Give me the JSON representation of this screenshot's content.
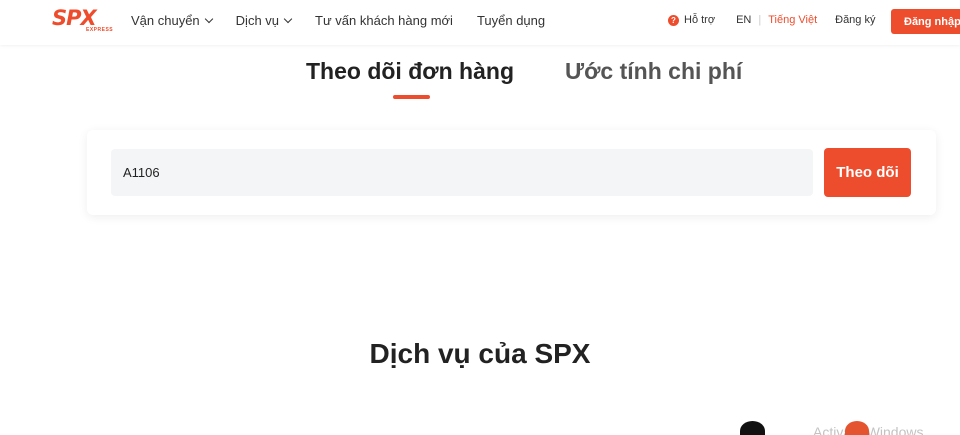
{
  "header": {
    "logo": {
      "text": "SPX",
      "subtext": "EXPRESS"
    },
    "nav": [
      {
        "label": "Vận chuyển",
        "has_dropdown": true
      },
      {
        "label": "Dịch vụ",
        "has_dropdown": true
      },
      {
        "label": "Tư vấn khách hàng mới",
        "has_dropdown": false
      },
      {
        "label": "Tuyển dụng",
        "has_dropdown": false
      }
    ],
    "help_label": "Hỗ trợ",
    "lang_en": "EN",
    "lang_vi": "Tiếng Việt",
    "signup_label": "Đăng ký",
    "login_label": "Đăng nhập"
  },
  "tabs": {
    "track": "Theo dõi đơn hàng",
    "estimate": "Ước tính chi phí",
    "active": "track"
  },
  "search": {
    "value": "A1106",
    "button_label": "Theo dõi"
  },
  "section": {
    "title": "Dịch vụ của SPX"
  },
  "watermark": "Activate Windows",
  "colors": {
    "accent": "#ee4d2d"
  }
}
